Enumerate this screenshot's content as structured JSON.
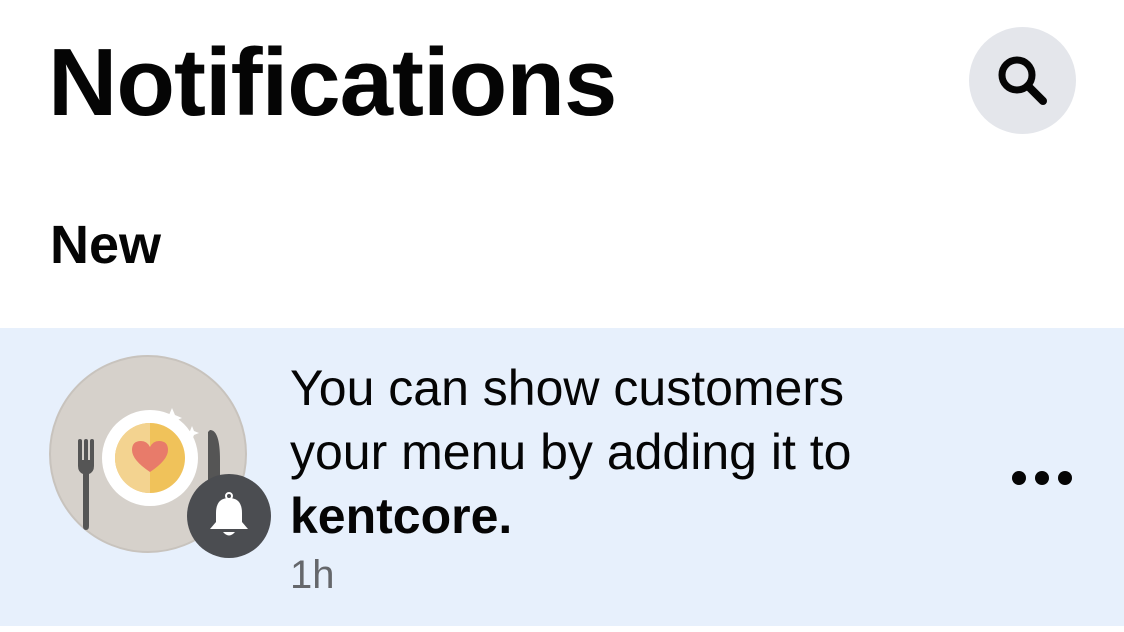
{
  "header": {
    "title": "Notifications",
    "search_icon": "search-icon"
  },
  "sections": {
    "new_label": "New"
  },
  "notification": {
    "message_line1": "You can show customers",
    "message_line2": "your menu by adding it to",
    "page_name": "kentcore.",
    "time": "1h",
    "avatar_icon": "plate-fork-knife-heart-icon",
    "badge_icon": "bell-icon",
    "more_icon": "more-dots-icon"
  },
  "colors": {
    "unread_background": "#e7f0fc",
    "search_button_bg": "#e4e6eb",
    "badge_bg": "#4b4d51",
    "secondary_text": "#65676b"
  }
}
